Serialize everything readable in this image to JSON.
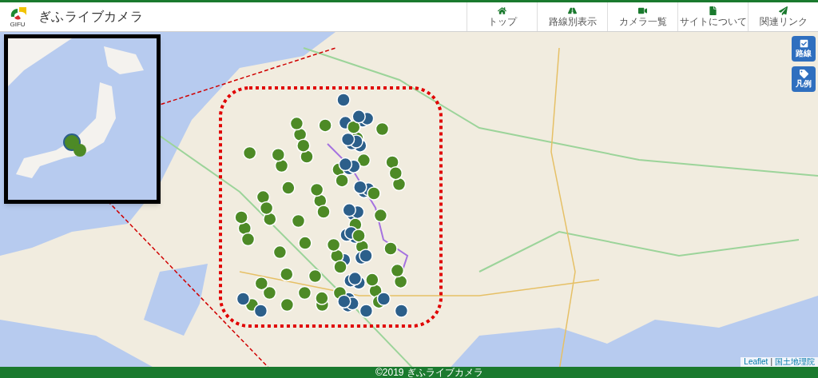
{
  "header": {
    "logo_text": "GIFU",
    "title": "ぎふライブカメラ"
  },
  "nav": [
    {
      "label": "トップ"
    },
    {
      "label": "路線別表示"
    },
    {
      "label": "カメラ一覧"
    },
    {
      "label": "サイトについて"
    },
    {
      "label": "関連リンク"
    }
  ],
  "map_controls": [
    {
      "label": "路線"
    },
    {
      "label": "凡例"
    }
  ],
  "attribution": {
    "links": [
      "Leaflet",
      "国土地理院"
    ],
    "separator": "|"
  },
  "footer": {
    "copyright": "©2019 ぎふライブカメラ"
  }
}
